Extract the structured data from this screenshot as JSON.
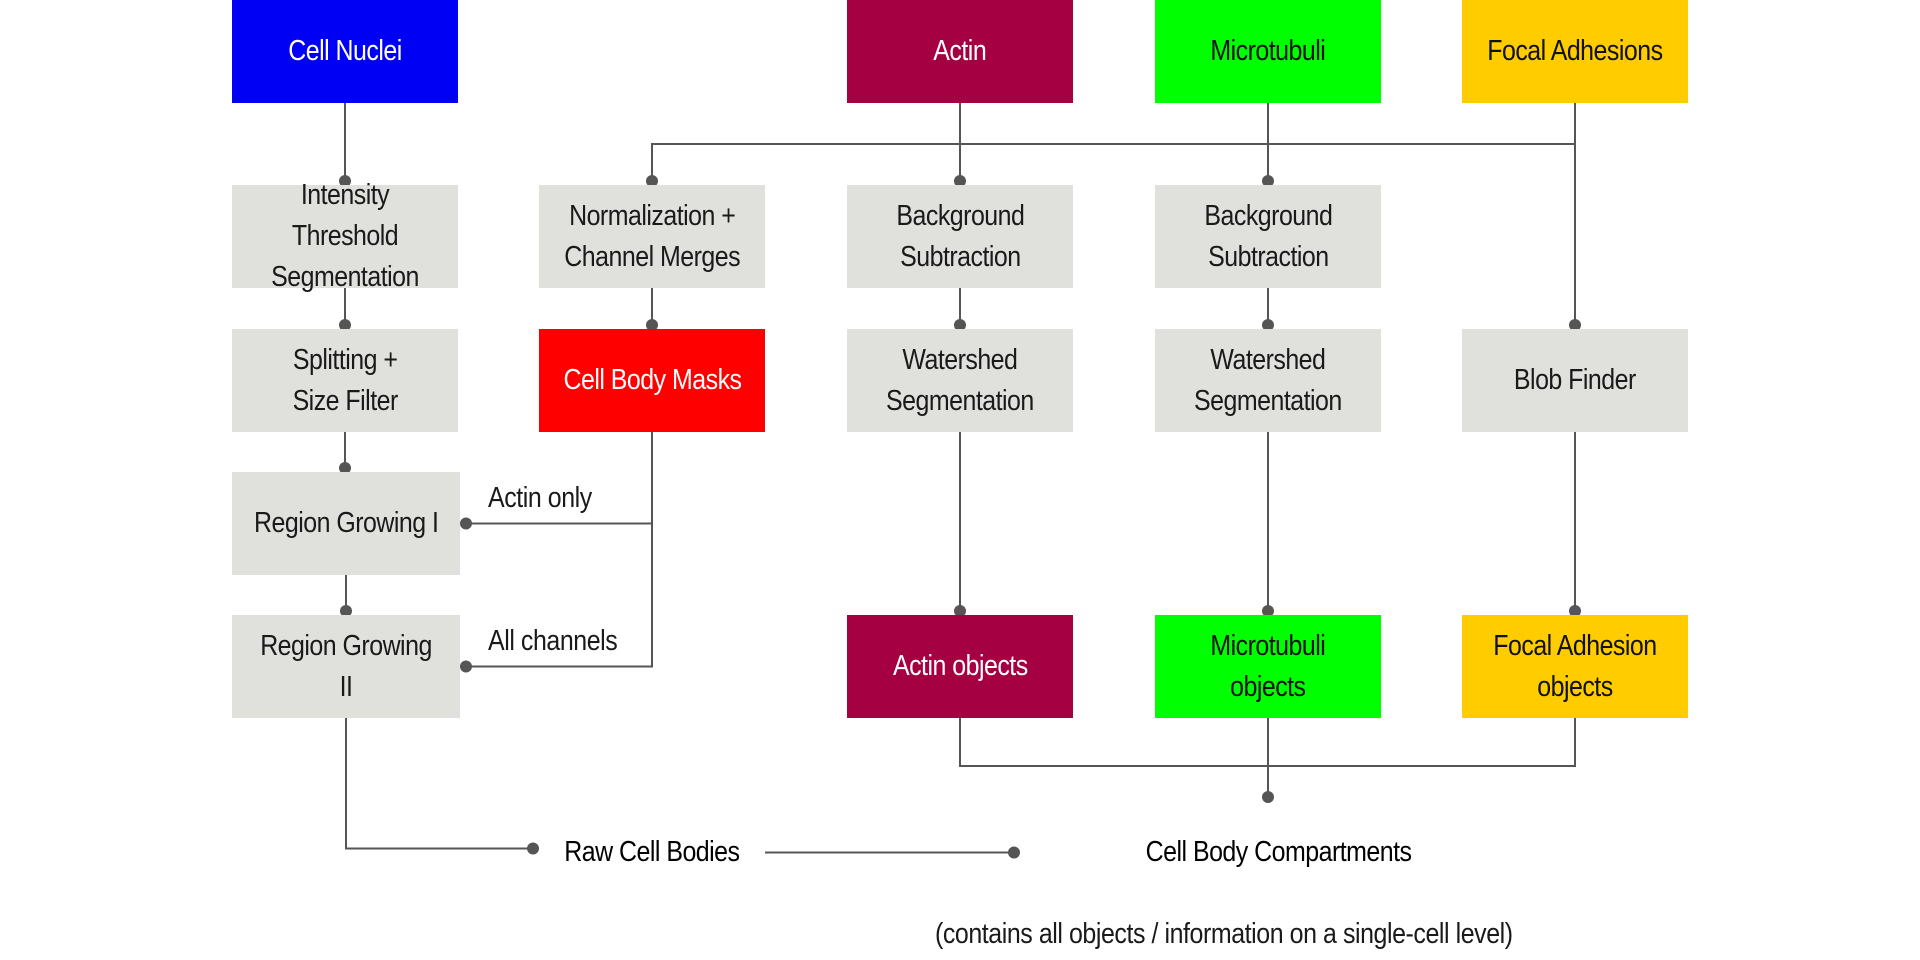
{
  "colors": {
    "nuclei": "#0000f5",
    "actin": "#a50041",
    "microtubuli": "#00ff00",
    "focal": "#ffcc00",
    "output": "#ff0000",
    "process": "#e0e0dc",
    "line": "#555555"
  },
  "diagram": {
    "channels": [
      {
        "id": "nuclei",
        "label": "Cell Nuclei",
        "color_key": "nuclei",
        "text_color": "#ffffff"
      },
      {
        "id": "actin",
        "label": "Actin",
        "color_key": "actin",
        "text_color": "#ffffff"
      },
      {
        "id": "microtubuli",
        "label": "Microtubuli",
        "color_key": "microtubuli",
        "text_color": "#111111"
      },
      {
        "id": "focal",
        "label": "Focal Adhesions",
        "color_key": "focal",
        "text_color": "#111111"
      }
    ],
    "steps": {
      "intensity_threshold": "Intensity Threshold\nSegmentation",
      "normalization": "Normalization +\nChannel Merges",
      "bg_sub_actin": "Background\nSubtraction",
      "bg_sub_mt": "Background\nSubtraction",
      "splitting": "Splitting +\nSize Filter",
      "cell_body_masks": "Cell Body Masks",
      "watershed_actin": "Watershed\nSegmentation",
      "watershed_mt": "Watershed\nSegmentation",
      "blob_finder": "Blob Finder",
      "region_growing_1": "Region Growing I",
      "region_growing_2": "Region Growing II",
      "actin_objects": "Actin objects",
      "mt_objects": "Microtubuli\nobjects",
      "fa_objects": "Focal Adhesion\nobjects",
      "raw_cell_bodies": "Raw Cell Bodies",
      "compartments": "Cell Body Compartments"
    },
    "edge_labels": {
      "actin_only": "Actin only",
      "all_channels": "All channels"
    },
    "caption": "(contains all objects / information on a single-cell level)"
  }
}
